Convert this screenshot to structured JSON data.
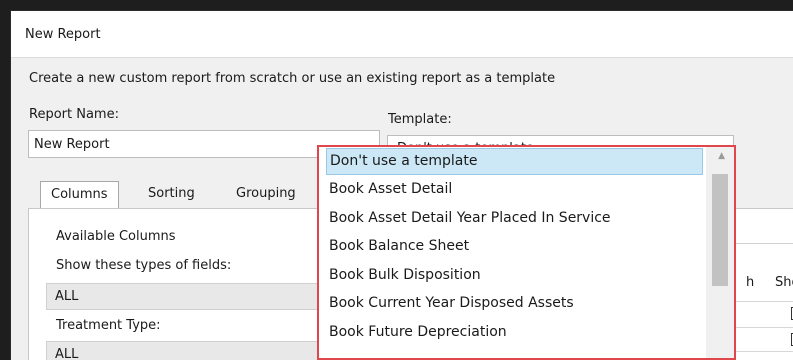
{
  "window": {
    "title": "New Report"
  },
  "intro_text": "Create a new custom report from scratch or use an existing report as a template",
  "report_name": {
    "label": "Report Name:",
    "value": "New Report"
  },
  "template": {
    "label": "Template:",
    "selected": "Don't use a template",
    "chevron": "⌄",
    "options": [
      "Don't use a template",
      "Book  Asset Detail",
      "Book  Asset Detail Year Placed In Service",
      "Book  Balance Sheet",
      "Book  Bulk Disposition",
      "Book  Current Year Disposed Assets",
      "Book  Future Depreciation"
    ]
  },
  "tabs": [
    {
      "label": "Columns"
    },
    {
      "label": "Sorting"
    },
    {
      "label": "Grouping"
    }
  ],
  "columns_panel": {
    "available_columns_label": "Available Columns",
    "field_types_label": "Show these types of fields:",
    "field_types_value": "ALL",
    "treatment_label": "Treatment Type:",
    "treatment_value": "ALL",
    "grid_header_1": "h",
    "grid_header_2": "Sho"
  },
  "icons": {
    "scroll_up": "scroll-up-arrow-icon",
    "checkbox": "checkbox-icon"
  },
  "colors": {
    "highlight_border": "#e0474c",
    "selected_item": "#cce8f7"
  }
}
